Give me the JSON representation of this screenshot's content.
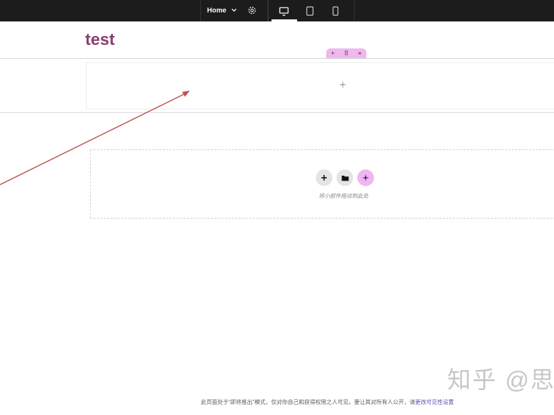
{
  "toolbar": {
    "page_selector_label": "Home",
    "device_active": "desktop"
  },
  "site": {
    "title": "test"
  },
  "container_toolbar": {
    "add_symbol": "+",
    "drag_symbol": "⠿",
    "close_symbol": "×"
  },
  "container": {
    "add_symbol": "+"
  },
  "drop_area": {
    "hint": "将小部件拖动到此处"
  },
  "footer": {
    "notice": "此页面处于“即将推出”模式，仅对你自己和获得权限之人可见。要让其对所有人公开，请",
    "link": "更改可见性设置"
  },
  "watermark": {
    "text": "知乎 @思"
  },
  "colors": {
    "topbar": "#1c1c1c",
    "title": "#8b3e6e",
    "accent_pink": "#efb6f0",
    "arrow": "#c0504d"
  }
}
